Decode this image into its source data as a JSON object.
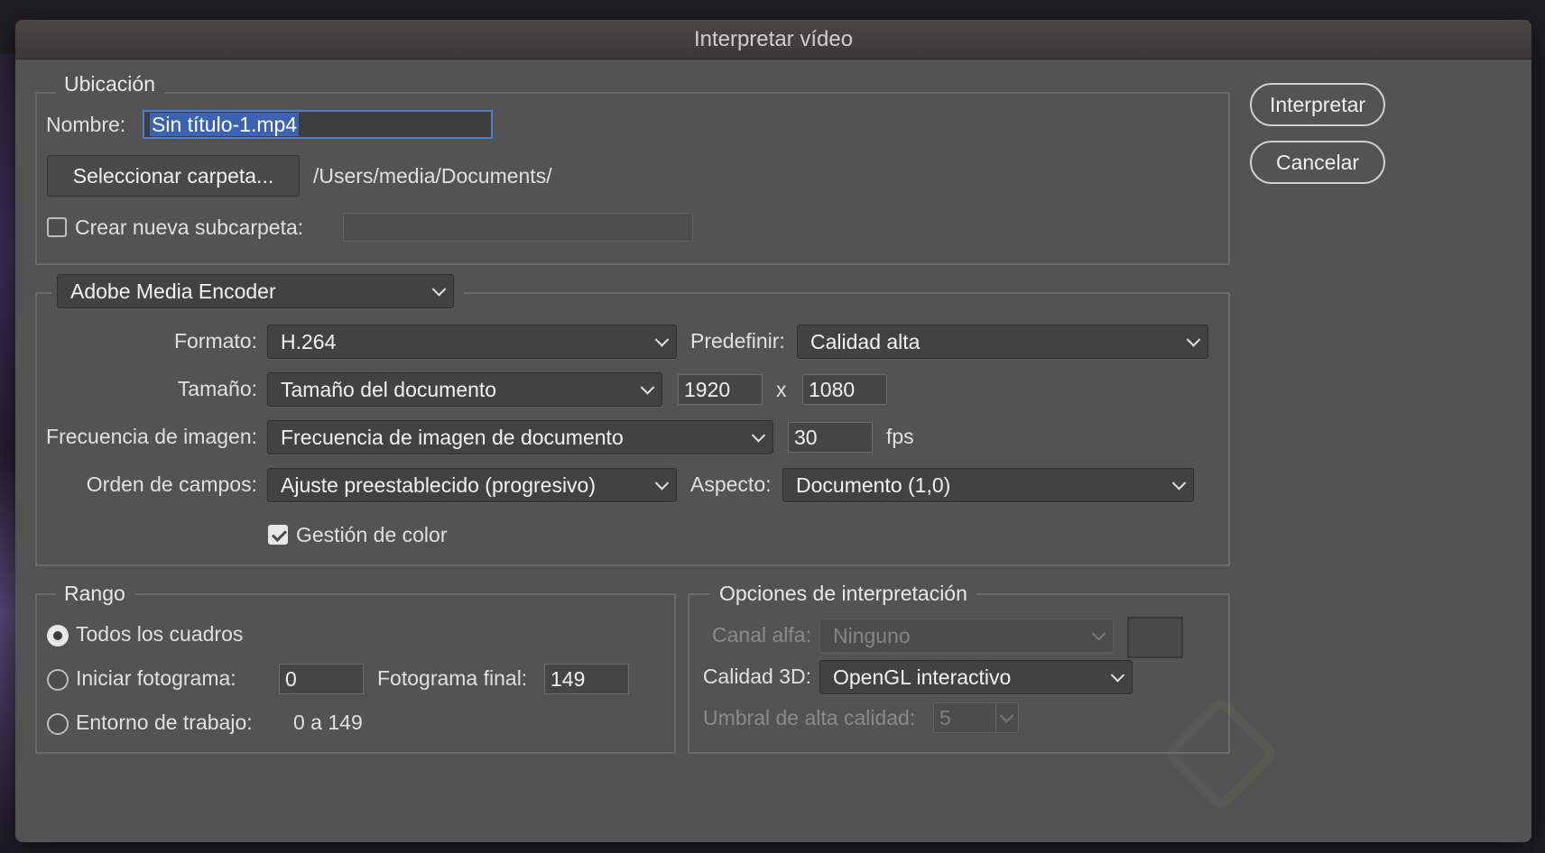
{
  "window": {
    "title": "Interpretar vídeo"
  },
  "location": {
    "legend": "Ubicación",
    "name_label": "Nombre:",
    "name_value": "Sin título-1.mp4",
    "select_folder_button": "Seleccionar carpeta...",
    "folder_path": "/Users/media/Documents/",
    "new_subfolder_label": "Crear nueva subcarpeta:",
    "new_subfolder_checked": false,
    "new_subfolder_value": ""
  },
  "encoder": {
    "selected": "Adobe Media Encoder",
    "format_label": "Formato:",
    "format_value": "H.264",
    "preset_label": "Predefinir:",
    "preset_value": "Calidad alta",
    "size_label": "Tamaño:",
    "size_value": "Tamaño del documento",
    "width": "1920",
    "x_sep": "x",
    "height": "1080",
    "framerate_label": "Frecuencia de imagen:",
    "framerate_value": "Frecuencia de imagen de documento",
    "fps_value": "30",
    "fps_unit": "fps",
    "field_order_label": "Orden de campos:",
    "field_order_value": "Ajuste preestablecido (progresivo)",
    "aspect_label": "Aspecto:",
    "aspect_value": "Documento (1,0)",
    "color_mgmt_label": "Gestión de color",
    "color_mgmt_checked": true
  },
  "range": {
    "legend": "Rango",
    "all_frames_label": "Todos los cuadros",
    "start_frame_label": "Iniciar fotograma:",
    "start_frame_value": "0",
    "end_frame_label": "Fotograma final:",
    "end_frame_value": "149",
    "work_area_label": "Entorno de trabajo:",
    "work_area_value": "0 a 149",
    "selected": "Todos los cuadros"
  },
  "render_options": {
    "legend": "Opciones de interpretación",
    "alpha_label": "Canal alfa:",
    "alpha_value": "Ninguno",
    "quality3d_label": "Calidad 3D:",
    "quality3d_value": "OpenGL interactivo",
    "threshold_label": "Umbral de alta calidad:",
    "threshold_value": "5"
  },
  "buttons": {
    "render": "Interpretar",
    "cancel": "Cancelar"
  }
}
